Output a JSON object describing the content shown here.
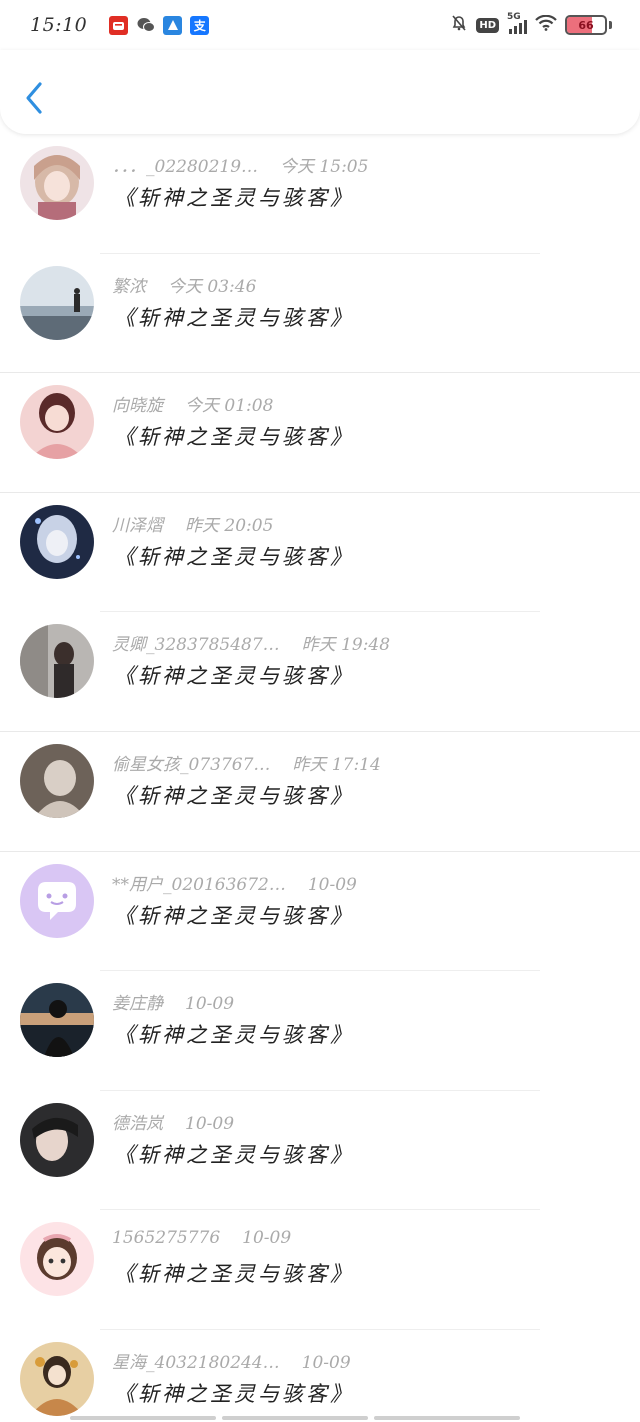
{
  "status_bar": {
    "time": "15:10",
    "app_icons": [
      "pinduoduo-icon",
      "wechat-icon",
      "map-icon",
      "alipay-icon"
    ],
    "alipay_label": "支",
    "network": "5G",
    "hd": "HD",
    "battery": "66",
    "battery_level_percent": 66
  },
  "colors": {
    "accent": "#2f8fe0",
    "name_text": "#aaaaaa",
    "message_text": "#222222",
    "battery_fill": "#ec6f7c"
  },
  "messages": [
    {
      "name": "．．．_02280219…",
      "time": "今天 15:05",
      "text": "《斩神之圣灵与骇客》",
      "avatar": "anime-girl-avatar"
    },
    {
      "name": "繁浓",
      "time": "今天 03:46",
      "text": "《斩神之圣灵与骇客》",
      "avatar": "seaside-avatar"
    },
    {
      "name": "向晓旋",
      "time": "今天 01:08",
      "text": "《斩神之圣灵与骇客》",
      "avatar": "girl-pink-avatar"
    },
    {
      "name": "川泽熠",
      "time": "昨天 20:05",
      "text": "《斩神之圣灵与骇客》",
      "avatar": "fantasy-girl-avatar"
    },
    {
      "name": "灵卿_3283785487…",
      "time": "昨天 19:48",
      "text": "《斩神之圣灵与骇客》",
      "avatar": "girl-street-avatar"
    },
    {
      "name": "偷星女孩_073767…",
      "time": "昨天 17:14",
      "text": "《斩神之圣灵与骇客》",
      "avatar": "girl-brown-avatar"
    },
    {
      "name": "**用户_020163672…",
      "time": "10-09",
      "text": "《斩神之圣灵与骇客》",
      "avatar": "default-chat-avatar"
    },
    {
      "name": "姜庄静",
      "time": "10-09",
      "text": "《斩神之圣灵与骇客》",
      "avatar": "sunset-silhouette-avatar"
    },
    {
      "name": "德浩岚",
      "time": "10-09",
      "text": "《斩神之圣灵与骇客》",
      "avatar": "boy-dark-avatar"
    },
    {
      "name": "1565275776",
      "time": "10-09",
      "text": "《斩神之圣灵与骇客》",
      "avatar": "cartoon-girl-avatar"
    },
    {
      "name": "星海_4032180244…",
      "time": "10-09",
      "text": "《斩神之圣灵与骇客》",
      "avatar": "ancient-costume-avatar"
    }
  ]
}
